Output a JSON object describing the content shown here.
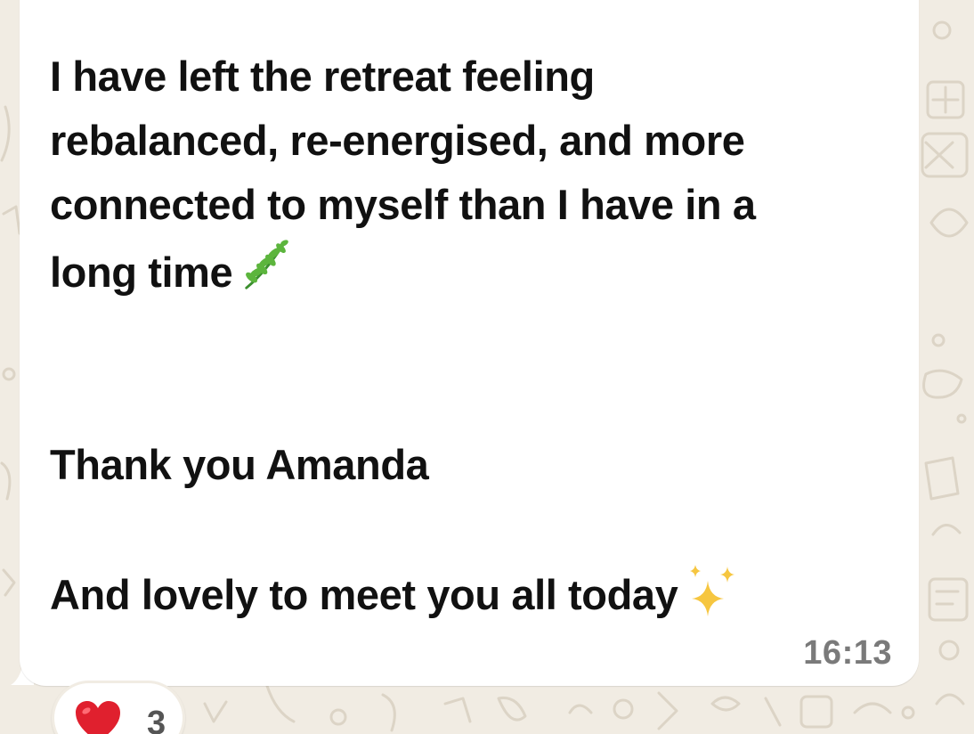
{
  "message": {
    "lines": [
      "I have left the retreat feeling",
      "rebalanced, re-energised, and more",
      "connected to myself than I have in a",
      "long time"
    ],
    "thanks": "Thank you Amanda",
    "closing": "And lovely to meet you all today",
    "line_end_emoji": "herb-icon",
    "closing_emoji": "sparkles-icon",
    "time": "16:13"
  },
  "reaction": {
    "icon": "red-heart-icon",
    "count": "3"
  },
  "colors": {
    "chat_background": "#f1ece3",
    "bubble": "#ffffff",
    "text": "#111111",
    "timestamp": "#7a7a7a",
    "heart": "#e0202e"
  }
}
